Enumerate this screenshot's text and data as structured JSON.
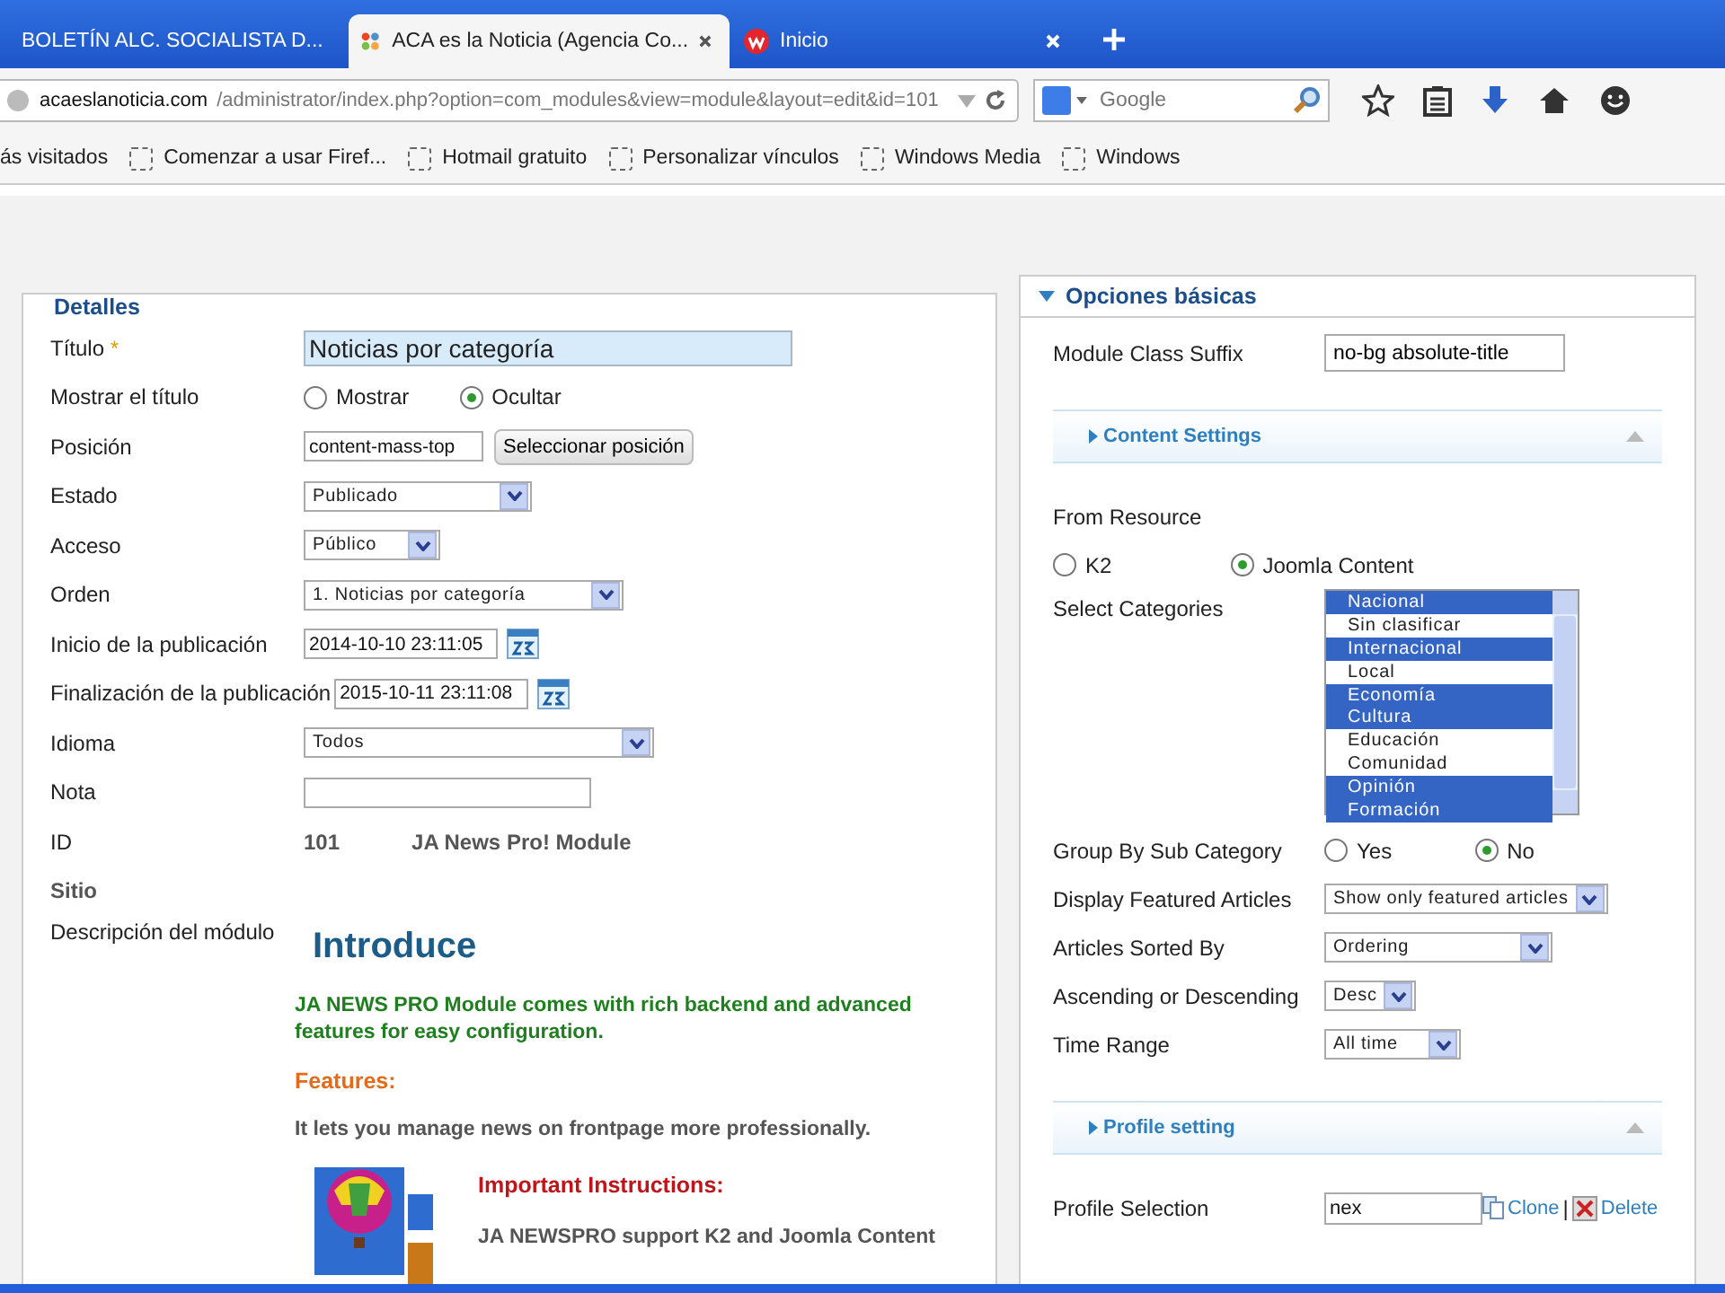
{
  "browser": {
    "tabs": [
      {
        "title": "BOLETÍN ALC. SOCIALISTA D...",
        "selected": false
      },
      {
        "title": "ACA es la Noticia (Agencia Co...",
        "selected": true
      },
      {
        "title": "Inicio",
        "selected": false
      }
    ],
    "url": {
      "host": "acaeslanoticia.com",
      "path": "/administrator/index.php?option=com_modules&view=module&layout=edit&id=101"
    },
    "search": {
      "placeholder": "Google"
    },
    "bookmarks": [
      "ás visitados",
      "Comenzar a usar Firef...",
      "Hotmail gratuito",
      "Personalizar vínculos",
      "Windows Media",
      "Windows"
    ]
  },
  "details": {
    "legend": "Detalles",
    "fields": [
      {
        "kind": "title",
        "label": "Título",
        "required_mark": "*",
        "value": "Noticias por categoría"
      },
      {
        "kind": "radio",
        "label": "Mostrar el título",
        "options": [
          {
            "label": "Mostrar",
            "selected": false
          },
          {
            "label": "Ocultar",
            "selected": true
          }
        ]
      },
      {
        "kind": "position",
        "label": "Posición",
        "value": "content-mass-top",
        "button": "Seleccionar posición"
      },
      {
        "kind": "select",
        "label": "Estado",
        "value": "Publicado"
      },
      {
        "kind": "select",
        "label": "Acceso",
        "value": "Público"
      },
      {
        "kind": "select",
        "label": "Orden",
        "value": "1. Noticias por categoría"
      },
      {
        "kind": "date",
        "label": "Inicio de la publicación",
        "value": "2014-10-10 23:11:05"
      },
      {
        "kind": "date",
        "label": "Finalización de la publicación",
        "value": "2015-10-11 23:11:08"
      },
      {
        "kind": "select",
        "label": "Idioma",
        "value": "Todos"
      },
      {
        "kind": "text",
        "label": "Nota"
      },
      {
        "kind": "id",
        "label": "ID",
        "value": "101",
        "module": "JA News Pro! Module"
      },
      {
        "kind": "heading",
        "label": "Sitio"
      }
    ],
    "description": {
      "label": "Descripción del módulo",
      "heading": "Introduce",
      "intro": "JA NEWS PRO Module comes with rich backend and advanced features for easy configuration.",
      "features_title": "Features:",
      "features_text": "It lets you manage news on frontpage more professionally.",
      "instructions_title": "Important Instructions:",
      "instructions_text": "JA NEWSPRO support K2 and Joomla Content"
    }
  },
  "options": {
    "title": "Opciones básicas",
    "expanded": true,
    "fields": [
      {
        "kind": "text",
        "label": "Module Class Suffix",
        "value": "no-bg absolute-title"
      },
      {
        "kind": "section",
        "label": "Content Settings"
      },
      {
        "kind": "label",
        "label": "From Resource"
      },
      {
        "kind": "radio",
        "options": [
          {
            "label": "K2",
            "selected": false
          },
          {
            "label": "Joomla Content",
            "selected": true
          }
        ]
      },
      {
        "kind": "list",
        "label": "Select Categories",
        "options": [
          {
            "label": "Nacional",
            "selected": true
          },
          {
            "label": "Sin clasificar",
            "selected": false
          },
          {
            "label": "Internacional",
            "selected": true
          },
          {
            "label": "Local",
            "selected": false
          },
          {
            "label": "Economía",
            "selected": true
          },
          {
            "label": "Cultura",
            "selected": true
          },
          {
            "label": "Educación",
            "selected": false
          },
          {
            "label": "Comunidad",
            "selected": false
          },
          {
            "label": "Opinión",
            "selected": true
          },
          {
            "label": "Formación",
            "selected": true
          }
        ]
      },
      {
        "kind": "radio",
        "label": "Group By Sub Category",
        "options": [
          {
            "label": "Yes",
            "selected": false
          },
          {
            "label": "No",
            "selected": true
          }
        ]
      },
      {
        "kind": "select",
        "label": "Display Featured Articles",
        "value": "Show only featured articles"
      },
      {
        "kind": "select",
        "label": "Articles Sorted By",
        "value": "Ordering"
      },
      {
        "kind": "select",
        "label": "Ascending or Descending",
        "value": "Desc"
      },
      {
        "kind": "select",
        "label": "Time Range",
        "value": "All time"
      },
      {
        "kind": "section",
        "label": "Profile setting"
      },
      {
        "kind": "profile",
        "label": "Profile Selection",
        "value": "nex",
        "clone": "Clone",
        "separator": "|",
        "delete": "Delete"
      }
    ]
  }
}
